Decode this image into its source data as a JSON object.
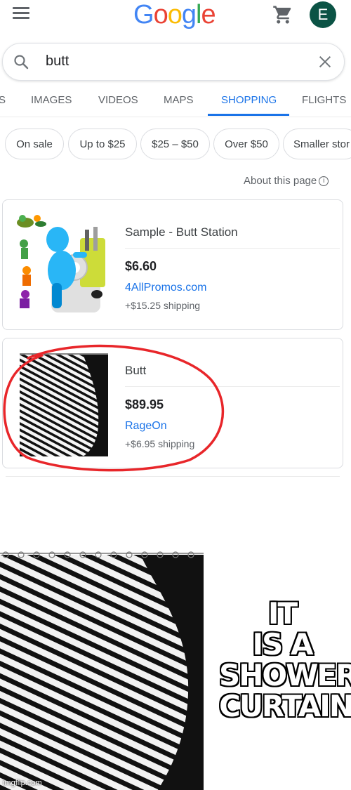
{
  "header": {
    "logo_letters": [
      "G",
      "o",
      "o",
      "g",
      "l",
      "e"
    ],
    "logo_colors": [
      "#4285F4",
      "#EA4335",
      "#FBBC05",
      "#4285F4",
      "#34A853",
      "#EA4335"
    ],
    "avatar_initial": "E",
    "avatar_color": "#0b5345"
  },
  "search": {
    "query": "butt"
  },
  "tabs": [
    {
      "label": "S"
    },
    {
      "label": "IMAGES"
    },
    {
      "label": "VIDEOS"
    },
    {
      "label": "MAPS"
    },
    {
      "label": "SHOPPING",
      "active": true
    },
    {
      "label": "FLIGHTS"
    }
  ],
  "chips": [
    {
      "label": "On sale"
    },
    {
      "label": "Up to $25"
    },
    {
      "label": "$25 – $50"
    },
    {
      "label": "Over $50"
    },
    {
      "label": "Smaller stor"
    }
  ],
  "about": {
    "label": "About this page"
  },
  "products": [
    {
      "title": "Sample - Butt Station",
      "price": "$6.60",
      "merchant": "4AllPromos.com",
      "shipping": "+$15.25 shipping"
    },
    {
      "title": "Butt",
      "price": "$89.95",
      "merchant": "RageOn",
      "shipping": "+$6.95 shipping",
      "highlighted": true
    }
  ],
  "meme": {
    "caption_lines": [
      "IT",
      "IS A",
      "SHOWER",
      "CURTAIN"
    ],
    "watermark": "imgflip.com"
  },
  "colors": {
    "accent": "#1a73e8",
    "highlight_circle": "#e8262a"
  }
}
